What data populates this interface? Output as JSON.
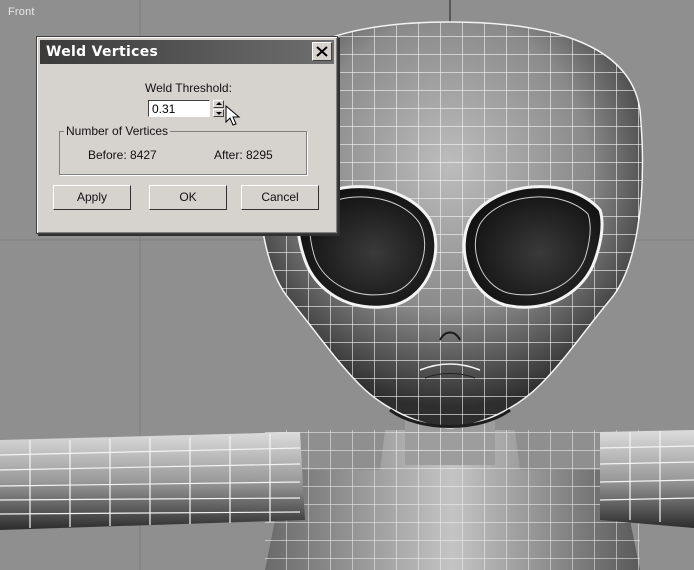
{
  "viewport": {
    "label": "Front"
  },
  "dialog": {
    "title": "Weld Vertices",
    "threshold_label": "Weld Threshold:",
    "threshold_value": "0.31",
    "group_label": "Number of Vertices",
    "before": "Before: 8427",
    "after": "After:  8295",
    "buttons": {
      "apply": "Apply",
      "ok": "OK",
      "cancel": "Cancel"
    }
  },
  "colors": {
    "viewport_bg": "#8f8f8f",
    "wire": "#f2f2f2",
    "dialog_bg": "#d6d3ce",
    "titlebar": "#3a3a3a"
  },
  "icons": {
    "close": "close-icon",
    "spinner": "spinner-arrows-icon",
    "cursor": "mouse-cursor-icon"
  }
}
